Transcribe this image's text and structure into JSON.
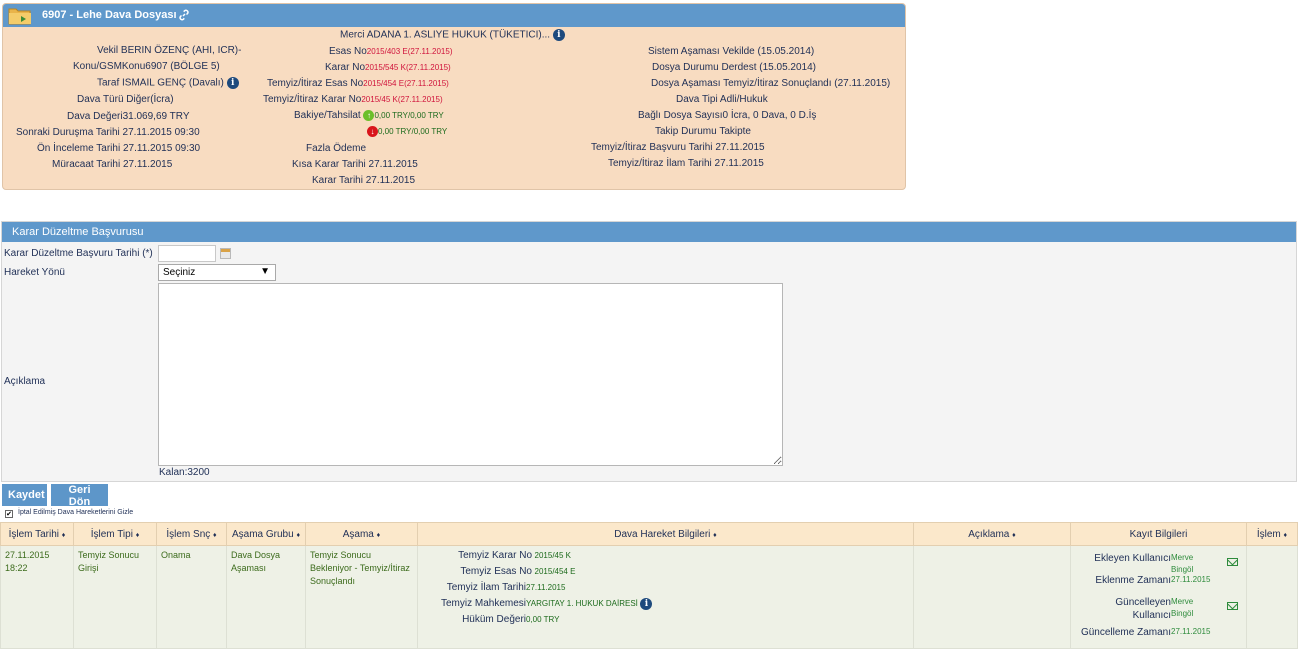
{
  "case": {
    "title": "6907 - Lehe Dava Dosyası",
    "left": {
      "vekil_label": "Vekil",
      "vekil_value": "BERIN ÖZENÇ (AHI, ICR)-",
      "konu_label": "Konu/GSMKonu",
      "konu_value": "6907 (BÖLGE 5)",
      "taraf_label": "Taraf",
      "taraf_value": "ISMAIL GENÇ (Davalı)",
      "dava_turu_label": "Dava Türü",
      "dava_turu_value": "Diğer(İcra)",
      "dava_degeri_label": "Dava Değeri",
      "dava_degeri_value": "31.069,69 TRY",
      "sonraki_durusma_label": "Sonraki Duruşma Tarihi",
      "sonraki_durusma_value": "27.11.2015 09:30",
      "on_inceleme_label": "Ön İnceleme Tarihi",
      "on_inceleme_value": "27.11.2015 09:30",
      "muracaat_label": "Müracaat Tarihi",
      "muracaat_value": "27.11.2015"
    },
    "middle": {
      "merci_label": "Merci",
      "merci_value": "ADANA 1. ASLIYE HUKUK (TÜKETICI)...",
      "esas_no_label": "Esas No",
      "esas_no_value": "2015/403 E(27.11.2015)",
      "karar_no_label": "Karar No",
      "karar_no_value": "2015/545 K(27.11.2015)",
      "temyiz_esas_label": "Temyiz/İtiraz Esas No",
      "temyiz_esas_value": "2015/454 E(27.11.2015)",
      "temyiz_karar_label": "Temyiz/İtiraz Karar No",
      "temyiz_karar_value": "2015/45 K(27.11.2015)",
      "bakiye_label": "Bakiye/Tahsilat",
      "bakiye_value": "0,00 TRY/0,00 TRY",
      "bakiye_value2": "0,00 TRY/0,00 TRY",
      "fazla_odeme_label": "Fazla Ödeme",
      "kisa_karar_label": "Kısa Karar Tarihi",
      "kisa_karar_value": "27.11.2015",
      "karar_tarihi_label": "Karar Tarihi",
      "karar_tarihi_value": "27.11.2015"
    },
    "right": {
      "sistem_asamasi_label": "Sistem Aşaması",
      "sistem_asamasi_value": "Vekilde (15.05.2014)",
      "dosya_durumu_label": "Dosya Durumu",
      "dosya_durumu_value": "Derdest (15.05.2014)",
      "dosya_asamasi_label": "Dosya Aşaması",
      "dosya_asamasi_value": "Temyiz/İtiraz Sonuçlandı (27.11.2015)",
      "dava_tipi_label": "Dava Tipi",
      "dava_tipi_value": "Adli/Hukuk",
      "bagli_dosya_label": "Bağlı Dosya Sayısı",
      "bagli_dosya_value": "0 İcra, 0 Dava, 0 D.İş",
      "takip_durumu_label": "Takip Durumu",
      "takip_durumu_value": "Takipte",
      "temyiz_basvuru_label": "Temyiz/İtiraz Başvuru Tarihi",
      "temyiz_basvuru_value": "27.11.2015",
      "temyiz_ilam_label": "Temyiz/İtiraz İlam Tarihi",
      "temyiz_ilam_value": "27.11.2015"
    }
  },
  "form": {
    "title": "Karar Düzeltme Başvurusu",
    "date_label": "Karar Düzeltme Başvuru Tarihi (*)",
    "date_value": "",
    "direction_label": "Hareket Yönü",
    "direction_selected": "Seçiniz",
    "description_label": "Açıklama",
    "remaining": "Kalan:3200",
    "save_label": "Kaydet",
    "back_label": "Geri Dön",
    "hide_cancelled_label": "İptal Edilmiş Dava Hareketlerini Gizle"
  },
  "grid": {
    "headers": [
      "İşlem Tarihi",
      "İşlem Tipi",
      "İşlem Snç",
      "Aşama Grubu",
      "Aşama",
      "Dava Hareket Bilgileri",
      "Açıklama",
      "Kayıt Bilgileri",
      "İşlem"
    ],
    "row": {
      "islem_tarihi": "27.11.2015 18:22",
      "islem_tipi": "Temyiz Sonucu Girişi",
      "islem_snc": "Onama",
      "asama_grubu": "Dava Dosya Aşaması",
      "asama": "Temyiz Sonucu Bekleniyor - Temyiz/İtiraz Sonuçlandı",
      "hareket": {
        "temyiz_karar_label": "Temyiz Karar No",
        "temyiz_karar_value": "2015/45 K",
        "temyiz_esas_label": "Temyiz Esas No",
        "temyiz_esas_value": "2015/454 E",
        "temyiz_ilam_label": "Temyiz İlam Tarihi",
        "temyiz_ilam_value": "27.11.2015",
        "temyiz_mahkeme_label": "Temyiz Mahkemesi",
        "temyiz_mahkeme_value": "YARGITAY 1. HUKUK DAİRESİ",
        "hukum_degeri_label": "Hüküm Değeri",
        "hukum_degeri_value": "0,00 TRY"
      },
      "kayit": {
        "ekleyen_label": "Ekleyen Kullanıcı",
        "ekleyen_value": "Merve Bingöl",
        "eklenme_label": "Eklenme Zamanı",
        "eklenme_value": "27.11.2015",
        "guncelleyen_label": "Güncelleyen Kullanıcı",
        "guncelleyen_value": "Merve Bingöl",
        "guncelleme_label": "Güncelleme Zamanı",
        "guncelleme_value": "27.11.2015"
      }
    }
  },
  "colors": {
    "header_blue": "#5f98cb",
    "panel_bg": "#f8dcc1",
    "grid_header": "#fbe8cb",
    "value_red": "#d0143c",
    "value_green": "#1d6b1d"
  },
  "icons": [
    "folder-icon",
    "link-icon",
    "info-icon",
    "up-arrow-icon",
    "down-arrow-icon",
    "calendar-icon",
    "mail-icon"
  ]
}
